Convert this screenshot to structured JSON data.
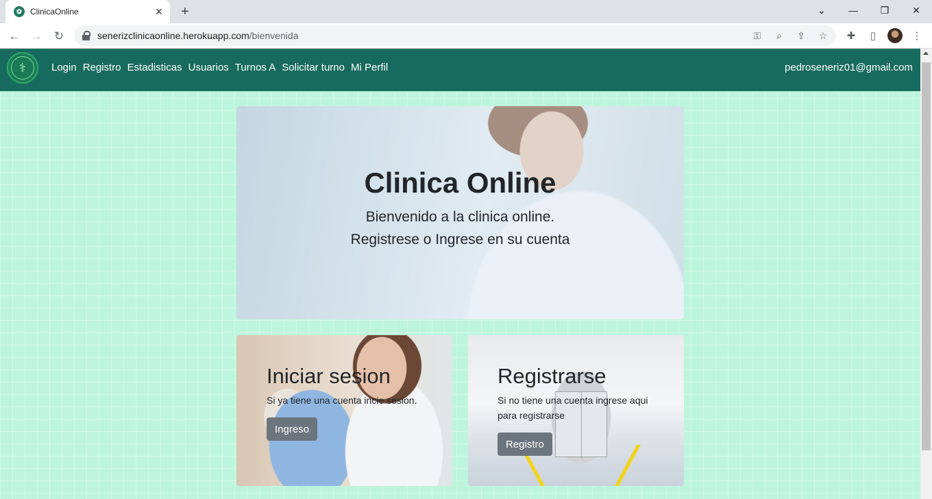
{
  "browser": {
    "tab_title": "ClinicaOnline",
    "tab_favicon": "leaf-icon",
    "url_host": "senerizclinicaonline.herokuapp.com",
    "url_path": "/bienvenida"
  },
  "navbar": {
    "links": [
      "Login",
      "Registro",
      "Estadisticas",
      "Usuarios",
      "Turnos A",
      "Solicitar turno",
      "Mi Perfil"
    ],
    "user_email": "pedroseneriz01@gmail.com",
    "color": "#176b5e"
  },
  "hero": {
    "title": "Clinica Online",
    "lead_line1": "Bienvenido a la clinica online.",
    "lead_line2": "Registrese o Ingrese en su cuenta"
  },
  "cards": {
    "login": {
      "title": "Iniciar sesion",
      "text": "Si ya tiene una cuenta incie sesion.",
      "button": "Ingreso"
    },
    "register": {
      "title": "Registrarse",
      "text": "Si no tiene una cuenta ingrese aqui para registrarse",
      "button": "Registro"
    }
  },
  "colors": {
    "page_background": "#bdf5dc",
    "button": "#6c757d"
  }
}
